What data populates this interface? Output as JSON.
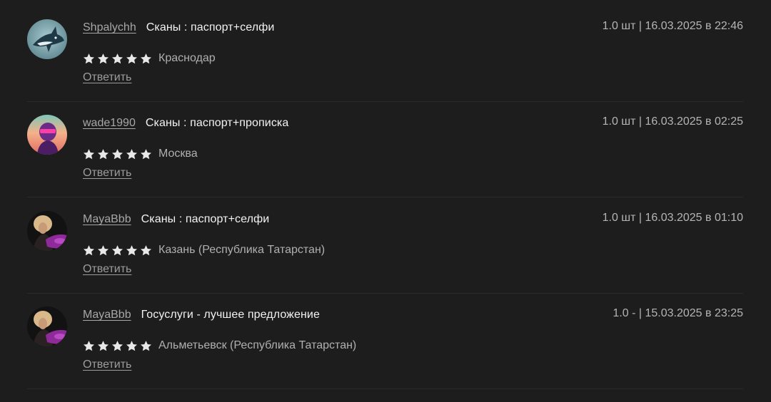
{
  "reviews": [
    {
      "username": "Shpalychh",
      "product": "Сканы : паспорт+селфи",
      "meta": "1.0 шт | 16.03.2025 в 22:46",
      "rating": 5,
      "city": "Краснодар",
      "reply_label": "Ответить",
      "avatar_icon": "shark-avatar"
    },
    {
      "username": "wade1990",
      "product": "Сканы : паспорт+прописка",
      "meta": "1.0 шт | 16.03.2025 в 02:25",
      "rating": 5,
      "city": "Москва",
      "reply_label": "Ответить",
      "avatar_icon": "neon-portrait-avatar"
    },
    {
      "username": "MayaBbb",
      "product": "Сканы : паспорт+селфи",
      "meta": "1.0 шт | 16.03.2025 в 01:10",
      "rating": 5,
      "city": "Казань (Республика Татарстан)",
      "reply_label": "Ответить",
      "avatar_icon": "woman-car-avatar"
    },
    {
      "username": "MayaBbb",
      "product": "Госуслуги - лучшее предложение",
      "meta": "1.0 - | 15.03.2025 в 23:25",
      "rating": 5,
      "city": "Альметьевск (Республика Татарстан)",
      "reply_label": "Ответить",
      "avatar_icon": "woman-car-avatar"
    }
  ],
  "colors": {
    "background": "#1d1d1d",
    "star": "#e8e8e8",
    "divider": "#2b2b2b"
  }
}
